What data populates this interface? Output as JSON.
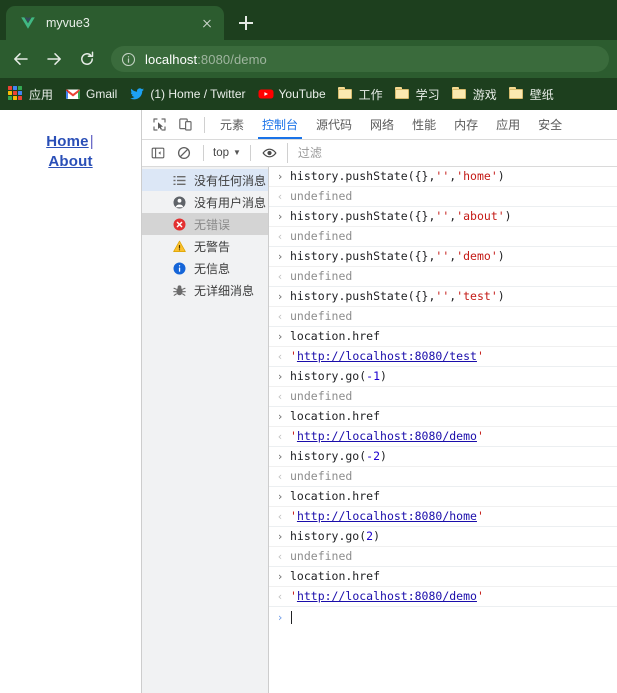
{
  "browser": {
    "tab": {
      "title": "myvue3",
      "favicon": "vue-logo-icon",
      "close_icon": "close-icon"
    },
    "newtab_icon": "plus-icon",
    "nav": {
      "back_icon": "back-arrow-icon",
      "forward_icon": "forward-arrow-icon",
      "reload_icon": "reload-icon"
    },
    "omnibox": {
      "info_icon": "info-circle-icon",
      "host": "localhost",
      "path": ":8080/demo",
      "full_url": "localhost:8080/demo"
    },
    "bookmarks": [
      {
        "label": "应用",
        "icon": "apps-grid-icon"
      },
      {
        "label": "Gmail",
        "icon": "gmail-icon"
      },
      {
        "label": "(1) Home / Twitter",
        "icon": "twitter-icon"
      },
      {
        "label": "YouTube",
        "icon": "youtube-icon"
      },
      {
        "label": "工作",
        "icon": "folder-icon"
      },
      {
        "label": "学习",
        "icon": "folder-icon"
      },
      {
        "label": "游戏",
        "icon": "folder-icon"
      },
      {
        "label": "壁纸",
        "icon": "folder-icon"
      }
    ]
  },
  "page": {
    "link_home": "Home",
    "separator": "|",
    "link_about": "About"
  },
  "devtools": {
    "inspect_icon": "inspect-element-icon",
    "device_icon": "device-toolbar-icon",
    "tabs": [
      {
        "label": "元素",
        "active": false
      },
      {
        "label": "控制台",
        "active": true
      },
      {
        "label": "源代码",
        "active": false
      },
      {
        "label": "网络",
        "active": false
      },
      {
        "label": "性能",
        "active": false
      },
      {
        "label": "内存",
        "active": false
      },
      {
        "label": "应用",
        "active": false
      },
      {
        "label": "安全",
        "active": false
      }
    ],
    "filterbar": {
      "sidebar_toggle_icon": "sidebar-toggle-icon",
      "clear_icon": "clear-console-icon",
      "context": "top",
      "context_caret": "▼",
      "eye_icon": "eye-icon",
      "filter_placeholder": "过滤"
    },
    "sidebar": [
      {
        "label": "没有任何消息",
        "icon": "list-icon",
        "state": "selected"
      },
      {
        "label": "没有用户消息",
        "icon": "user-icon",
        "state": "normal"
      },
      {
        "label": "无错误",
        "icon": "error-icon",
        "state": "hovered"
      },
      {
        "label": "无警告",
        "icon": "warning-icon",
        "state": "normal"
      },
      {
        "label": "无信息",
        "icon": "info-icon",
        "state": "normal"
      },
      {
        "label": "无详细消息",
        "icon": "verbose-icon",
        "state": "normal"
      }
    ],
    "console": {
      "input_marker": "›",
      "output_marker": "‹",
      "entries": [
        {
          "type": "input",
          "tokens": [
            {
              "t": "plain",
              "v": "history.pushState({},"
            },
            {
              "t": "str",
              "v": "''"
            },
            {
              "t": "plain",
              "v": ","
            },
            {
              "t": "str",
              "v": "'home'"
            },
            {
              "t": "plain",
              "v": ")"
            }
          ]
        },
        {
          "type": "output",
          "tokens": [
            {
              "t": "dim",
              "v": "undefined"
            }
          ]
        },
        {
          "type": "input",
          "tokens": [
            {
              "t": "plain",
              "v": "history.pushState({},"
            },
            {
              "t": "str",
              "v": "''"
            },
            {
              "t": "plain",
              "v": ","
            },
            {
              "t": "str",
              "v": "'about'"
            },
            {
              "t": "plain",
              "v": ")"
            }
          ]
        },
        {
          "type": "output",
          "tokens": [
            {
              "t": "dim",
              "v": "undefined"
            }
          ]
        },
        {
          "type": "input",
          "tokens": [
            {
              "t": "plain",
              "v": "history.pushState({},"
            },
            {
              "t": "str",
              "v": "''"
            },
            {
              "t": "plain",
              "v": ","
            },
            {
              "t": "str",
              "v": "'demo'"
            },
            {
              "t": "plain",
              "v": ")"
            }
          ]
        },
        {
          "type": "output",
          "tokens": [
            {
              "t": "dim",
              "v": "undefined"
            }
          ]
        },
        {
          "type": "input",
          "tokens": [
            {
              "t": "plain",
              "v": "history.pushState({},"
            },
            {
              "t": "str",
              "v": "''"
            },
            {
              "t": "plain",
              "v": ","
            },
            {
              "t": "str",
              "v": "'test'"
            },
            {
              "t": "plain",
              "v": ")"
            }
          ]
        },
        {
          "type": "output",
          "tokens": [
            {
              "t": "dim",
              "v": "undefined"
            }
          ]
        },
        {
          "type": "input",
          "tokens": [
            {
              "t": "plain",
              "v": "location.href"
            }
          ]
        },
        {
          "type": "output",
          "tokens": [
            {
              "t": "str",
              "v": "'"
            },
            {
              "t": "link",
              "v": "http://localhost:8080/test"
            },
            {
              "t": "str",
              "v": "'"
            }
          ]
        },
        {
          "type": "input",
          "tokens": [
            {
              "t": "plain",
              "v": "history.go("
            },
            {
              "t": "num",
              "v": "-1"
            },
            {
              "t": "plain",
              "v": ")"
            }
          ]
        },
        {
          "type": "output",
          "tokens": [
            {
              "t": "dim",
              "v": "undefined"
            }
          ]
        },
        {
          "type": "input",
          "tokens": [
            {
              "t": "plain",
              "v": "location.href"
            }
          ]
        },
        {
          "type": "output",
          "tokens": [
            {
              "t": "str",
              "v": "'"
            },
            {
              "t": "link",
              "v": "http://localhost:8080/demo"
            },
            {
              "t": "str",
              "v": "'"
            }
          ]
        },
        {
          "type": "input",
          "tokens": [
            {
              "t": "plain",
              "v": "history.go("
            },
            {
              "t": "num",
              "v": "-2"
            },
            {
              "t": "plain",
              "v": ")"
            }
          ]
        },
        {
          "type": "output",
          "tokens": [
            {
              "t": "dim",
              "v": "undefined"
            }
          ]
        },
        {
          "type": "input",
          "tokens": [
            {
              "t": "plain",
              "v": "location.href"
            }
          ]
        },
        {
          "type": "output",
          "tokens": [
            {
              "t": "str",
              "v": "'"
            },
            {
              "t": "link",
              "v": "http://localhost:8080/home"
            },
            {
              "t": "str",
              "v": "'"
            }
          ]
        },
        {
          "type": "input",
          "tokens": [
            {
              "t": "plain",
              "v": "history.go("
            },
            {
              "t": "num",
              "v": "2"
            },
            {
              "t": "plain",
              "v": ")"
            }
          ]
        },
        {
          "type": "output",
          "tokens": [
            {
              "t": "dim",
              "v": "undefined"
            }
          ]
        },
        {
          "type": "input",
          "tokens": [
            {
              "t": "plain",
              "v": "location.href"
            }
          ]
        },
        {
          "type": "output",
          "tokens": [
            {
              "t": "str",
              "v": "'"
            },
            {
              "t": "link",
              "v": "http://localhost:8080/demo"
            },
            {
              "t": "str",
              "v": "'"
            }
          ]
        }
      ],
      "prompt_value": ""
    }
  },
  "colors": {
    "browser_frame": "#1d3f1e",
    "browser_toolbar": "#2c5c2f",
    "accent_blue": "#1a73e8",
    "link_blue": "#1a0dab",
    "string_red": "#c41a16",
    "number_blue": "#1c00cf",
    "sidebar_bg": "#f1f2f3",
    "selected_row": "#dce7f6",
    "hovered_row": "#d4d4d4"
  }
}
